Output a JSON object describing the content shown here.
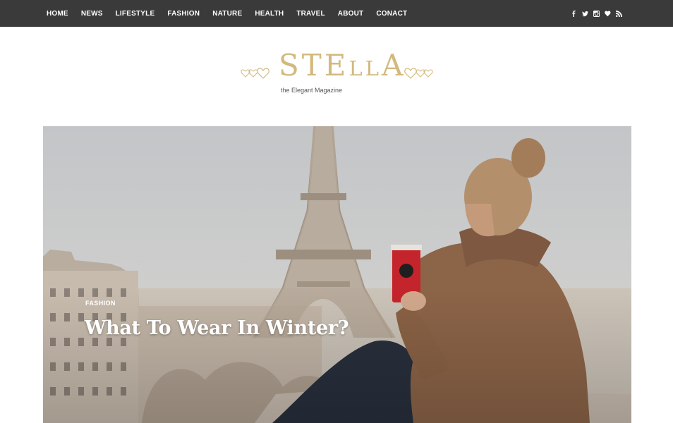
{
  "nav": {
    "items": [
      {
        "label": "HOME"
      },
      {
        "label": "NEWS"
      },
      {
        "label": "LIFESTYLE"
      },
      {
        "label": "FASHION"
      },
      {
        "label": "NATURE"
      },
      {
        "label": "HEALTH"
      },
      {
        "label": "TRAVEL"
      },
      {
        "label": "ABOUT"
      },
      {
        "label": "CONACT"
      }
    ],
    "social_icons": [
      "facebook-icon",
      "twitter-icon",
      "instagram-icon",
      "heart-icon",
      "rss-icon"
    ]
  },
  "header": {
    "logo_text": "STEllA",
    "tagline": "the Elegant Magazine",
    "logo_color": "#d2b97d"
  },
  "hero": {
    "category": "FASHION",
    "title": "What To Wear In Winter?"
  },
  "colors": {
    "topbar": "#3a3a3a",
    "accent": "#d2b97d",
    "cup": "#c4242b"
  }
}
